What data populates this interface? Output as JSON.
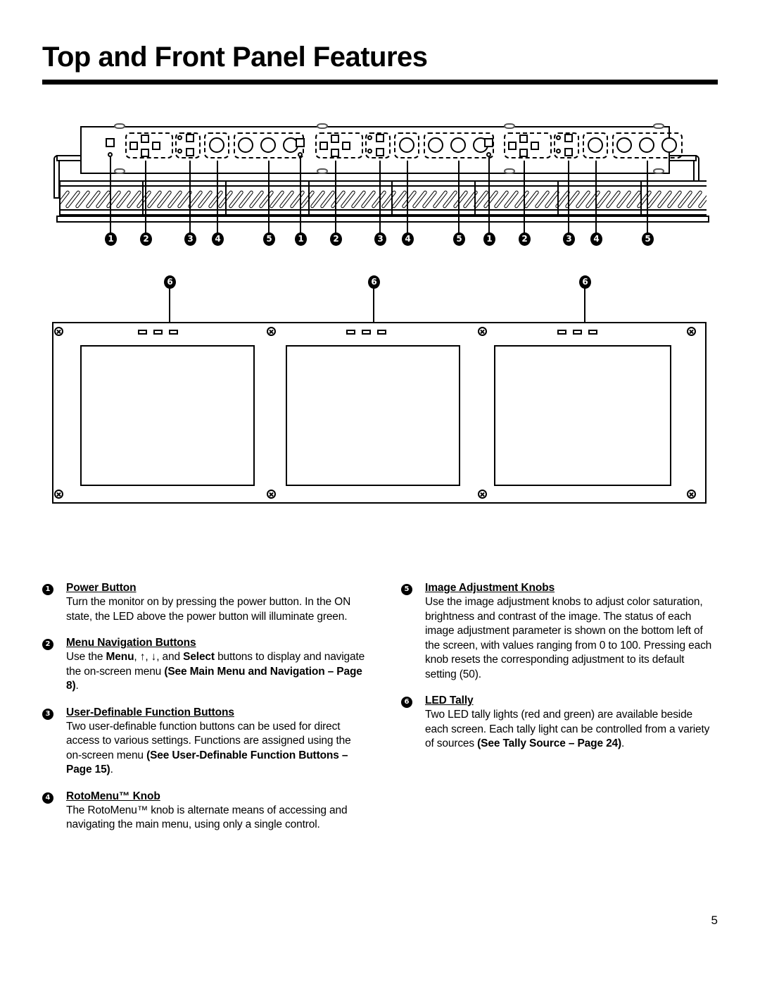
{
  "document": {
    "title": "Top and Front Panel Features",
    "page_number": "5"
  },
  "figure": {
    "top_panel_callouts": [
      {
        "label": "1"
      },
      {
        "label": "2"
      },
      {
        "label": "3"
      },
      {
        "label": "4"
      },
      {
        "label": "5"
      },
      {
        "label": "1"
      },
      {
        "label": "2"
      },
      {
        "label": "3"
      },
      {
        "label": "4"
      },
      {
        "label": "5"
      },
      {
        "label": "1"
      },
      {
        "label": "2"
      },
      {
        "label": "3"
      },
      {
        "label": "4"
      },
      {
        "label": "5"
      }
    ],
    "front_panel_callouts": [
      {
        "label": "6"
      },
      {
        "label": "6"
      },
      {
        "label": "6"
      }
    ],
    "controls": {
      "power_button": "power-button",
      "power_led": "power-led",
      "menu_navigation": "menu-navigation-buttons",
      "user_definable": "user-definable-function-buttons",
      "rotomenu_knob": "rotomenu-knob",
      "image_adjustment_knobs": "image-adjustment-knobs",
      "led_tally": "led-tally"
    }
  },
  "features": {
    "left_column": [
      {
        "number": "1",
        "heading": "Power Button ",
        "body_html": "Turn the monitor on by pressing the power button. In the ON state, the LED above the power button will illuminate green."
      },
      {
        "number": "2",
        "heading": "Menu Navigation Buttons",
        "body_html": "Use the <b>Menu</b>, ↑, ↓, and <b>Select</b> buttons to display and navigate the on-screen menu <b>(See Main Menu and Navigation – Page 8)</b>."
      },
      {
        "number": "3",
        "heading": "User-Definable Function Buttons",
        "body_html": "Two user-definable function buttons can be used for direct access to various settings. Functions are assigned using the on-screen menu <b>(See User-Definable Function Buttons – Page 15)</b>."
      },
      {
        "number": "4",
        "heading": "RotoMenu™ Knob",
        "body_html": "The RotoMenu™ knob is alternate means of accessing and navigating the main menu, using only a single control."
      }
    ],
    "right_column": [
      {
        "number": "5",
        "heading": "Image Adjustment Knobs",
        "body_html": "Use the image adjustment knobs to adjust color saturation, brightness and contrast of the image. The status of each image adjustment parameter is shown on the bottom left of the screen, with values ranging from 0 to 100. Pressing each knob resets the corresponding adjustment to its default setting (50)."
      },
      {
        "number": "6",
        "heading": "LED Tally",
        "body_html": "Two LED tally lights (red and green) are available beside each screen. Each tally light can be controlled from a variety of sources <b>(See Tally Source – Page 24)</b>."
      }
    ]
  }
}
